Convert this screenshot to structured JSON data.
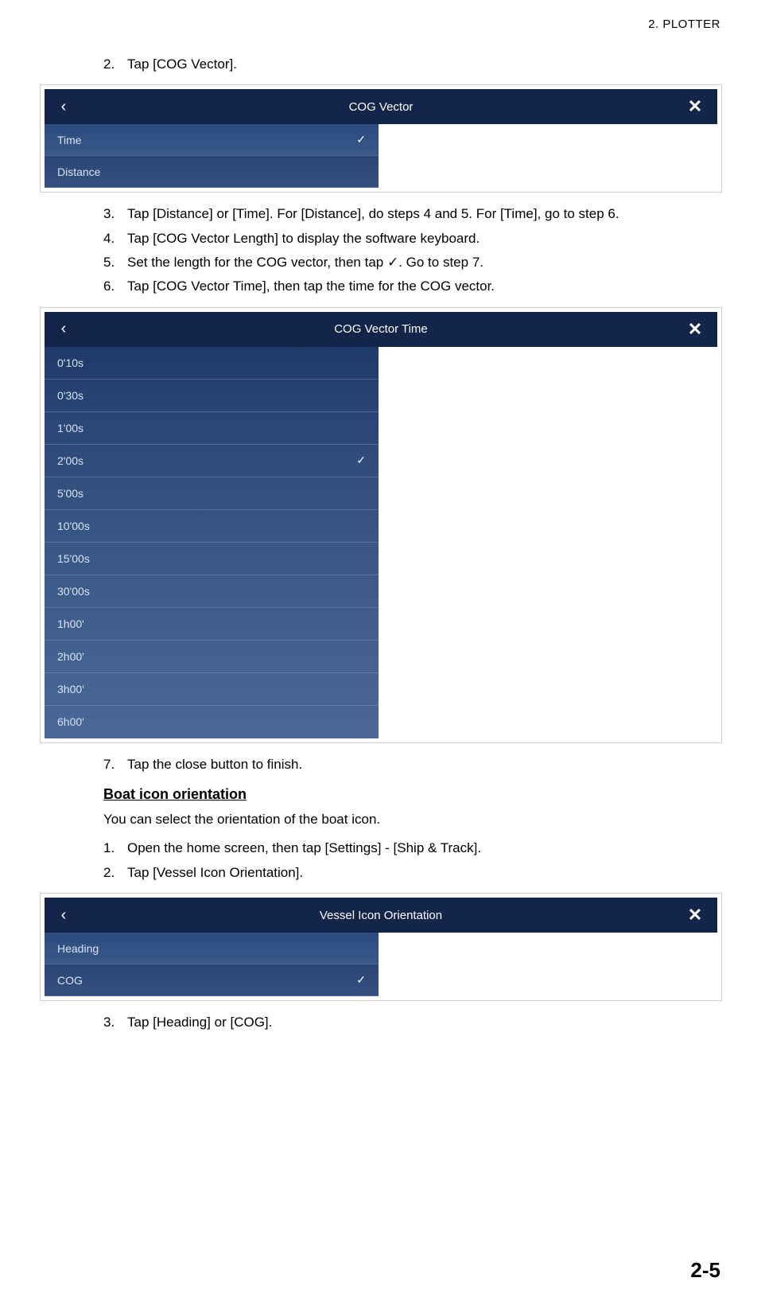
{
  "header": {
    "section": "2.  PLOTTER"
  },
  "stepsA": [
    {
      "num": "2.",
      "text": "Tap [COG Vector]."
    }
  ],
  "cogVectorPanel": {
    "title": "COG Vector",
    "back": "‹",
    "close": "✕",
    "items": [
      {
        "label": "Time",
        "checked": true
      },
      {
        "label": "Distance",
        "checked": false
      }
    ]
  },
  "stepsB": [
    {
      "num": "3.",
      "text": "Tap [Distance] or [Time]. For [Distance], do steps 4 and 5. For [Time], go to step 6."
    },
    {
      "num": "4.",
      "text": "Tap [COG Vector Length] to display the software keyboard."
    },
    {
      "num": "5.",
      "text": "Set the length for the COG vector, then tap ✓. Go to step 7."
    },
    {
      "num": "6.",
      "text": "Tap [COG Vector Time], then tap the time for the COG vector."
    }
  ],
  "cogVectorTimePanel": {
    "title": "COG Vector Time",
    "back": "‹",
    "close": "✕",
    "items": [
      {
        "label": "0'10s",
        "checked": false
      },
      {
        "label": "0'30s",
        "checked": false
      },
      {
        "label": "1'00s",
        "checked": false
      },
      {
        "label": "2'00s",
        "checked": true
      },
      {
        "label": "5'00s",
        "checked": false
      },
      {
        "label": "10'00s",
        "checked": false
      },
      {
        "label": "15'00s",
        "checked": false
      },
      {
        "label": "30'00s",
        "checked": false
      },
      {
        "label": "1h00'",
        "checked": false
      },
      {
        "label": "2h00'",
        "checked": false
      },
      {
        "label": "3h00'",
        "checked": false
      },
      {
        "label": "6h00'",
        "checked": false
      }
    ]
  },
  "stepsC": [
    {
      "num": "7.",
      "text": "Tap the close button to finish."
    }
  ],
  "boatSection": {
    "title": "Boat icon orientation",
    "intro": "You can select the orientation of the boat icon."
  },
  "stepsD": [
    {
      "num": "1.",
      "text": "Open the home screen, then tap [Settings] - [Ship & Track]."
    },
    {
      "num": "2.",
      "text": "Tap [Vessel Icon Orientation]."
    }
  ],
  "vesselPanel": {
    "title": "Vessel Icon Orientation",
    "back": "‹",
    "close": "✕",
    "items": [
      {
        "label": "Heading",
        "checked": false
      },
      {
        "label": "COG",
        "checked": true
      }
    ]
  },
  "stepsE": [
    {
      "num": "3.",
      "text": "Tap [Heading] or [COG]."
    }
  ],
  "pageNumber": "2-5"
}
